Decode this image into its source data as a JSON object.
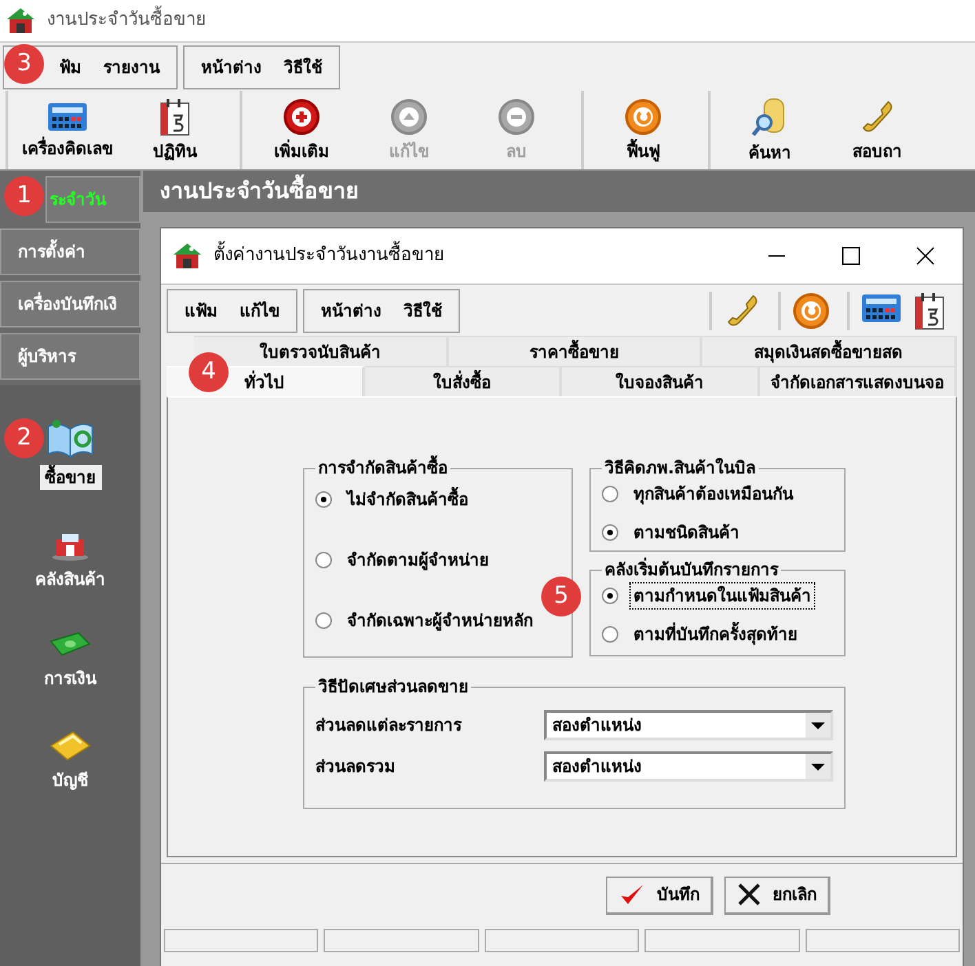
{
  "window": {
    "title": "งานประจำวันซื้อขาย"
  },
  "menu_groups": [
    [
      "ฟ้ม",
      "รายงาน"
    ],
    [
      "หน้าต่าง",
      "วิธีใช้"
    ]
  ],
  "toolbar": [
    [
      {
        "label": "เครื่องคิดเลข",
        "kind": "calculator",
        "disabled": false
      },
      {
        "label": "ปฏิทิน",
        "kind": "calendar",
        "disabled": false
      }
    ],
    [
      {
        "label": "เพิ่มเติม",
        "kind": "add",
        "disabled": false
      },
      {
        "label": "แก้ไข",
        "kind": "edit",
        "disabled": true
      },
      {
        "label": "ลบ",
        "kind": "delete",
        "disabled": true
      }
    ],
    [
      {
        "label": "ฟื้นฟู",
        "kind": "refresh",
        "disabled": false
      }
    ],
    [
      {
        "label": "ค้นหา",
        "kind": "search",
        "disabled": false
      },
      {
        "label": "สอบถา",
        "kind": "phone",
        "disabled": false
      }
    ]
  ],
  "sidebar": {
    "sections": [
      {
        "label": "ระจำวัน",
        "selected": true
      },
      {
        "label": "การตั้งค่า",
        "selected": false
      },
      {
        "label": "เครื่องบันทึกเงิ",
        "selected": false
      },
      {
        "label": "ผู้บริหาร",
        "selected": false
      }
    ],
    "modules": [
      {
        "label": "ซื้อขาย",
        "kind": "book",
        "selected": true
      },
      {
        "label": "คลังสินค้า",
        "kind": "warehouse",
        "selected": false
      },
      {
        "label": "การเงิน",
        "kind": "money",
        "selected": false
      },
      {
        "label": "บัญชี",
        "kind": "wallet",
        "selected": false
      }
    ]
  },
  "panel_title": "งานประจำวันซื้อขาย",
  "dialog": {
    "title": "ตั้งค่างานประจำวันงานซื้อขาย",
    "menu_groups": [
      [
        "แฟ้ม",
        "แก้ไข"
      ],
      [
        "หน้าต่าง",
        "วิธีใช้"
      ]
    ],
    "tab_rows": [
      [
        {
          "label": "ใบตรวจนับสินค้า",
          "selected": false
        },
        {
          "label": "ราคาซื้อขาย",
          "selected": false
        },
        {
          "label": "สมุดเงินสดซื้อขายสด",
          "selected": false
        }
      ],
      [
        {
          "label": "ทั่วไป",
          "selected": true
        },
        {
          "label": "ใบสั่งซื้อ",
          "selected": false
        },
        {
          "label": "ใบจองสินค้า",
          "selected": false
        },
        {
          "label": "จำกัดเอกสารแสดงบนจอ",
          "selected": false
        }
      ]
    ],
    "groups": [
      {
        "title": "การจำกัดสินค้าซื้อ",
        "options": [
          {
            "label": "ไม่จำกัดสินค้าซื้อ",
            "selected": true
          },
          {
            "label": "จำกัดตามผู้จำหน่าย",
            "selected": false
          },
          {
            "label": "จำกัดเฉพาะผู้จำหน่ายหลัก",
            "selected": false
          }
        ]
      },
      {
        "title": "วิธีคิดภพ.สินค้าในบิล",
        "options": [
          {
            "label": "ทุกสินค้าต้องเหมือนกัน",
            "selected": false
          },
          {
            "label": "ตามชนิดสินค้า",
            "selected": true
          }
        ]
      },
      {
        "title": "คลังเริ่มต้นบันทึกรายการ",
        "options": [
          {
            "label": "ตามกำหนดในแฟ้มสินค้า",
            "selected": true,
            "focused": true
          },
          {
            "label": "ตามที่บันทึกครั้งสุดท้าย",
            "selected": false,
            "focused": false
          }
        ]
      }
    ],
    "rounding": {
      "title": "วิธีปัดเศษส่วนลดขาย",
      "rows": [
        {
          "label": "ส่วนลดแต่ละรายการ",
          "value": "สองตำแหน่ง"
        },
        {
          "label": "ส่วนลดรวม",
          "value": "สองตำแหน่ง"
        }
      ]
    },
    "buttons": [
      {
        "label": "บันทึก",
        "kind": "check"
      },
      {
        "label": "ยกเลิก",
        "kind": "cross"
      }
    ]
  },
  "badges": [
    "3",
    "1",
    "4",
    "2",
    "5"
  ]
}
